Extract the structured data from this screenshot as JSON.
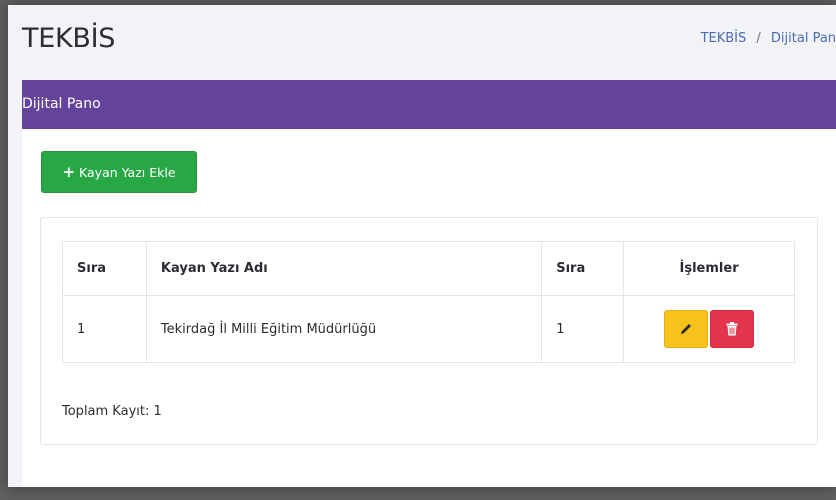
{
  "header": {
    "app_title": "TEKBİS"
  },
  "breadcrumb": {
    "root": "TEKBİS",
    "separator": "/",
    "current": "Dijital Pano"
  },
  "card": {
    "title": "Dijital Pano",
    "add_button_label": "Kayan Yazı Ekle"
  },
  "table": {
    "columns": [
      "Sıra",
      "Kayan Yazı Adı",
      "Sıra",
      "İşlemler"
    ],
    "rows": [
      {
        "cells": [
          "1",
          "Tekirdağ İl Milli Eğitim Müdürlüğü",
          "1"
        ]
      }
    ]
  },
  "footer": {
    "total_text": "Toplam Kayıt: 1"
  },
  "colors": {
    "header_purple": "#64449a",
    "add_green": "#28a745",
    "edit_yellow": "#f7c21a",
    "delete_red": "#e3344b",
    "link_blue": "#4a6bb0"
  },
  "icons": {
    "add": "plus-icon",
    "edit": "pencil-icon",
    "delete": "trash-icon"
  }
}
